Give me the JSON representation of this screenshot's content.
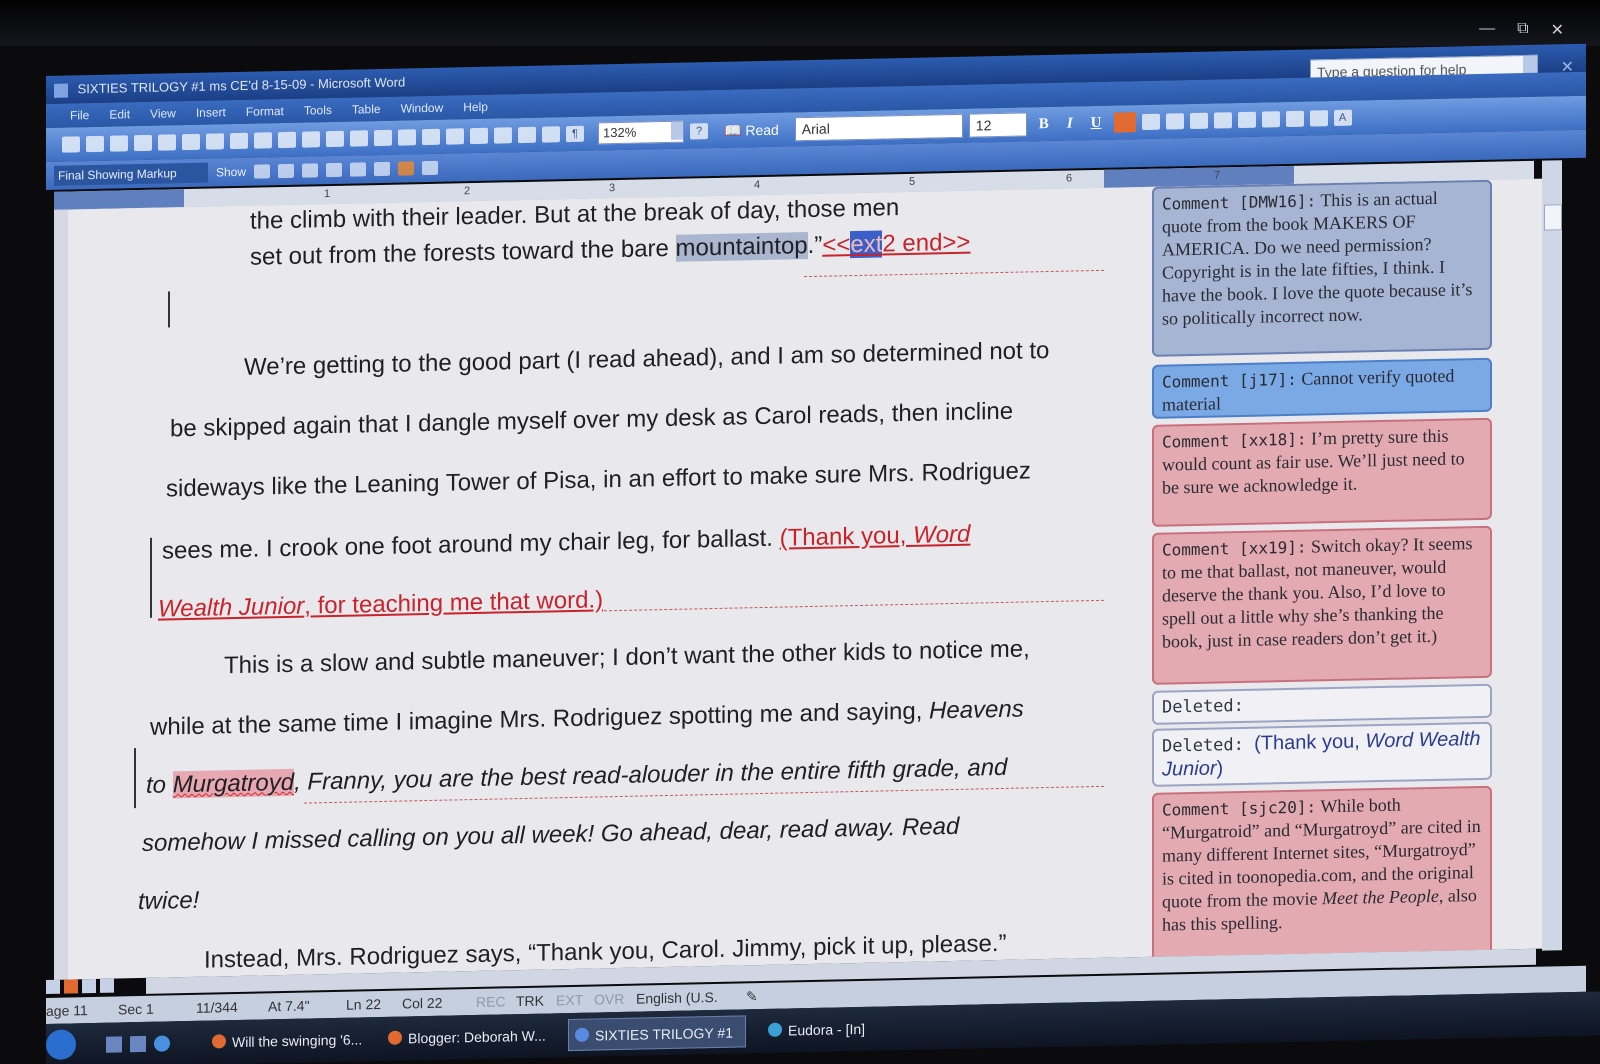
{
  "window": {
    "title": "SIXTIES TRILOGY #1 ms CE'd 8-15-09 - Microsoft Word",
    "help_placeholder": "Type a question for help"
  },
  "menu": [
    "File",
    "Edit",
    "View",
    "Insert",
    "Format",
    "Tools",
    "Table",
    "Window",
    "Help"
  ],
  "toolbar": {
    "zoom": "132%",
    "read_label": "Read",
    "font": "Arial",
    "font_size": "12"
  },
  "reviewing": {
    "display_mode": "Final Showing Markup",
    "show_label": "Show"
  },
  "ruler_numbers": [
    "1",
    "2",
    "3",
    "4",
    "5",
    "6",
    "7"
  ],
  "document": {
    "lines": [
      {
        "text": "the climb with their leader. But at the break of day, those men"
      },
      {
        "pre": "set out from the forests toward the bare ",
        "hl": "mountaintop",
        "mid": ".”",
        "ins_a": "<<",
        "sel": "ext",
        "ins_b": "2 end>>"
      },
      {
        "text": "We’re getting to the good part (I read ahead), and I am so determined not to"
      },
      {
        "text": "be skipped again that I dangle myself over my desk as Carol reads, then incline"
      },
      {
        "text": "sideways like the Leaning Tower of Pisa, in an effort to make sure Mrs. Rodriguez"
      },
      {
        "pre": "sees me. I crook one foot around my chair leg, for ballast. ",
        "ins_a": "(Thank you, ",
        "ins_it": "Word"
      },
      {
        "ins_it": "Wealth Junior",
        "ins_b": ", for teaching me that word.)"
      },
      {
        "text": "This is a slow and subtle maneuver; I don’t want the other kids to notice me,"
      },
      {
        "pre": "while at the same time I imagine Mrs. Rodriguez spotting me and saying, ",
        "it": "Heavens"
      },
      {
        "it_a": "to ",
        "spell": "Murgatroyd",
        "it_b": ", Franny, you are the best read-alouder in the entire fifth grade, and"
      },
      {
        "text": "somehow I missed calling on you all week! Go ahead, dear, read away. Read"
      },
      {
        "text": "twice!"
      },
      {
        "text": "Instead, Mrs. Rodriguez says, “Thank you, Carol. Jimmy, pick it up, please.”"
      }
    ]
  },
  "comments": [
    {
      "tag": "Comment [DMW16]:",
      "body": "This is an actual quote from the book MAKERS OF AMERICA. Do we need permission? Copyright is in the late fifties, I think. I have the book. I love the quote because it’s so politically incorrect now."
    },
    {
      "tag": "Comment [j17]:",
      "body": "Cannot verify quoted material"
    },
    {
      "tag": "Comment [xx18]:",
      "body": "I’m pretty sure this would count as fair use. We’ll just need to be sure we acknowledge it."
    },
    {
      "tag": "Comment [xx19]:",
      "body": "Switch okay? It seems to me that ballast, not maneuver, would deserve the thank you. Also, I’d love to spell out a little why she’s thanking the book, just in case readers don’t get it.)"
    },
    {
      "tag": "Deleted:",
      "body": ""
    },
    {
      "tag": "Deleted:",
      "body_a": "(Thank you, ",
      "body_it": "Word Wealth Junior",
      "body_b": ")"
    },
    {
      "tag": "Comment [sjc20]:",
      "body_a": "While both “Murgatroid” and “Murgatroyd” are cited in many different Internet sites, “Murgatroyd” is cited in toonopedia.com, and the original quote from the movie ",
      "body_it": "Meet the People",
      "body_b": ", also has this spelling."
    }
  ],
  "status": {
    "page": "age 11",
    "sec": "Sec 1",
    "pages": "11/344",
    "at": "At 7.4\"",
    "ln": "Ln 22",
    "col": "Col 22",
    "rec": "REC",
    "trk": "TRK",
    "ext": "EXT",
    "ovr": "OVR",
    "lang": "English (U.S."
  },
  "taskbar": [
    "Will the swinging '6...",
    "Blogger: Deborah W...",
    "SIXTIES TRILOGY #1 ...",
    "Eudora - [In]"
  ]
}
